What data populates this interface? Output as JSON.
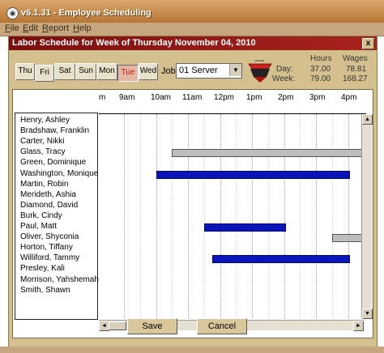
{
  "app": {
    "title": "v6.1.31 - Employee Scheduling"
  },
  "menu": [
    "File",
    "Edit",
    "Report",
    "Help"
  ],
  "dialog": {
    "title": "Labor Schedule for Week of Thursday November 04, 2010",
    "close": "x"
  },
  "days": [
    {
      "label": "Thu",
      "active": false
    },
    {
      "label": "Fri",
      "active": false
    },
    {
      "label": "Sat",
      "active": false
    },
    {
      "label": "Sun",
      "active": false
    },
    {
      "label": "Mon",
      "active": false
    },
    {
      "label": "Tue",
      "active": true
    },
    {
      "label": "Wed",
      "active": false
    }
  ],
  "job": {
    "label": "Job",
    "value": "01 Server"
  },
  "stats": {
    "hours_header": "Hours",
    "wages_header": "Wages",
    "day_label": "Day:",
    "week_label": "Week:",
    "day_hours": "37.00",
    "day_wages": "78.81",
    "week_hours": "79.00",
    "week_wages": "168.27"
  },
  "timeline": {
    "labels": [
      "m",
      "9am",
      "10am",
      "11am",
      "12pm",
      "1pm",
      "2pm",
      "3pm",
      "4pm"
    ]
  },
  "employees": [
    {
      "name": "Henry, Ashley"
    },
    {
      "name": "Bradshaw, Franklin"
    },
    {
      "name": "Carter, Nikki"
    },
    {
      "name": "Glass, Tracy"
    },
    {
      "name": "Green, Dominique"
    },
    {
      "name": "Washington, Monique"
    },
    {
      "name": "Martin, Robin"
    },
    {
      "name": "Merideth, Ashia"
    },
    {
      "name": "Diamond, David"
    },
    {
      "name": "Burk, Cindy"
    },
    {
      "name": "Paul, Matt"
    },
    {
      "name": "Oliver, Shyconia"
    },
    {
      "name": "Horton, Tiffany"
    },
    {
      "name": "Williford, Tammy"
    },
    {
      "name": "Presley, Kali"
    },
    {
      "name": "Morrison, Yahshemah"
    },
    {
      "name": "Smith, Shawn"
    }
  ],
  "shifts": [
    {
      "employee": "Glass, Tracy",
      "start": "10:30",
      "end": "4:00+",
      "status": "gray"
    },
    {
      "employee": "Washington, Monique",
      "start": "10:00",
      "end": "4:00",
      "status": "blue"
    },
    {
      "employee": "Paul, Matt",
      "start": "11:30",
      "end": "2:00",
      "status": "blue"
    },
    {
      "employee": "Oliver, Shyconia",
      "start": "3:30",
      "end": "4:00+",
      "status": "gray"
    },
    {
      "employee": "Williford, Tammy",
      "start": "11:45",
      "end": "4:00",
      "status": "blue"
    }
  ],
  "buttons": {
    "save": "Save",
    "cancel": "Cancel"
  },
  "colors": {
    "scheduled": "#0a14b8",
    "unavailable": "#bdbdbd",
    "titlebar": "#7a0f10",
    "active_day": "#cc1111"
  }
}
